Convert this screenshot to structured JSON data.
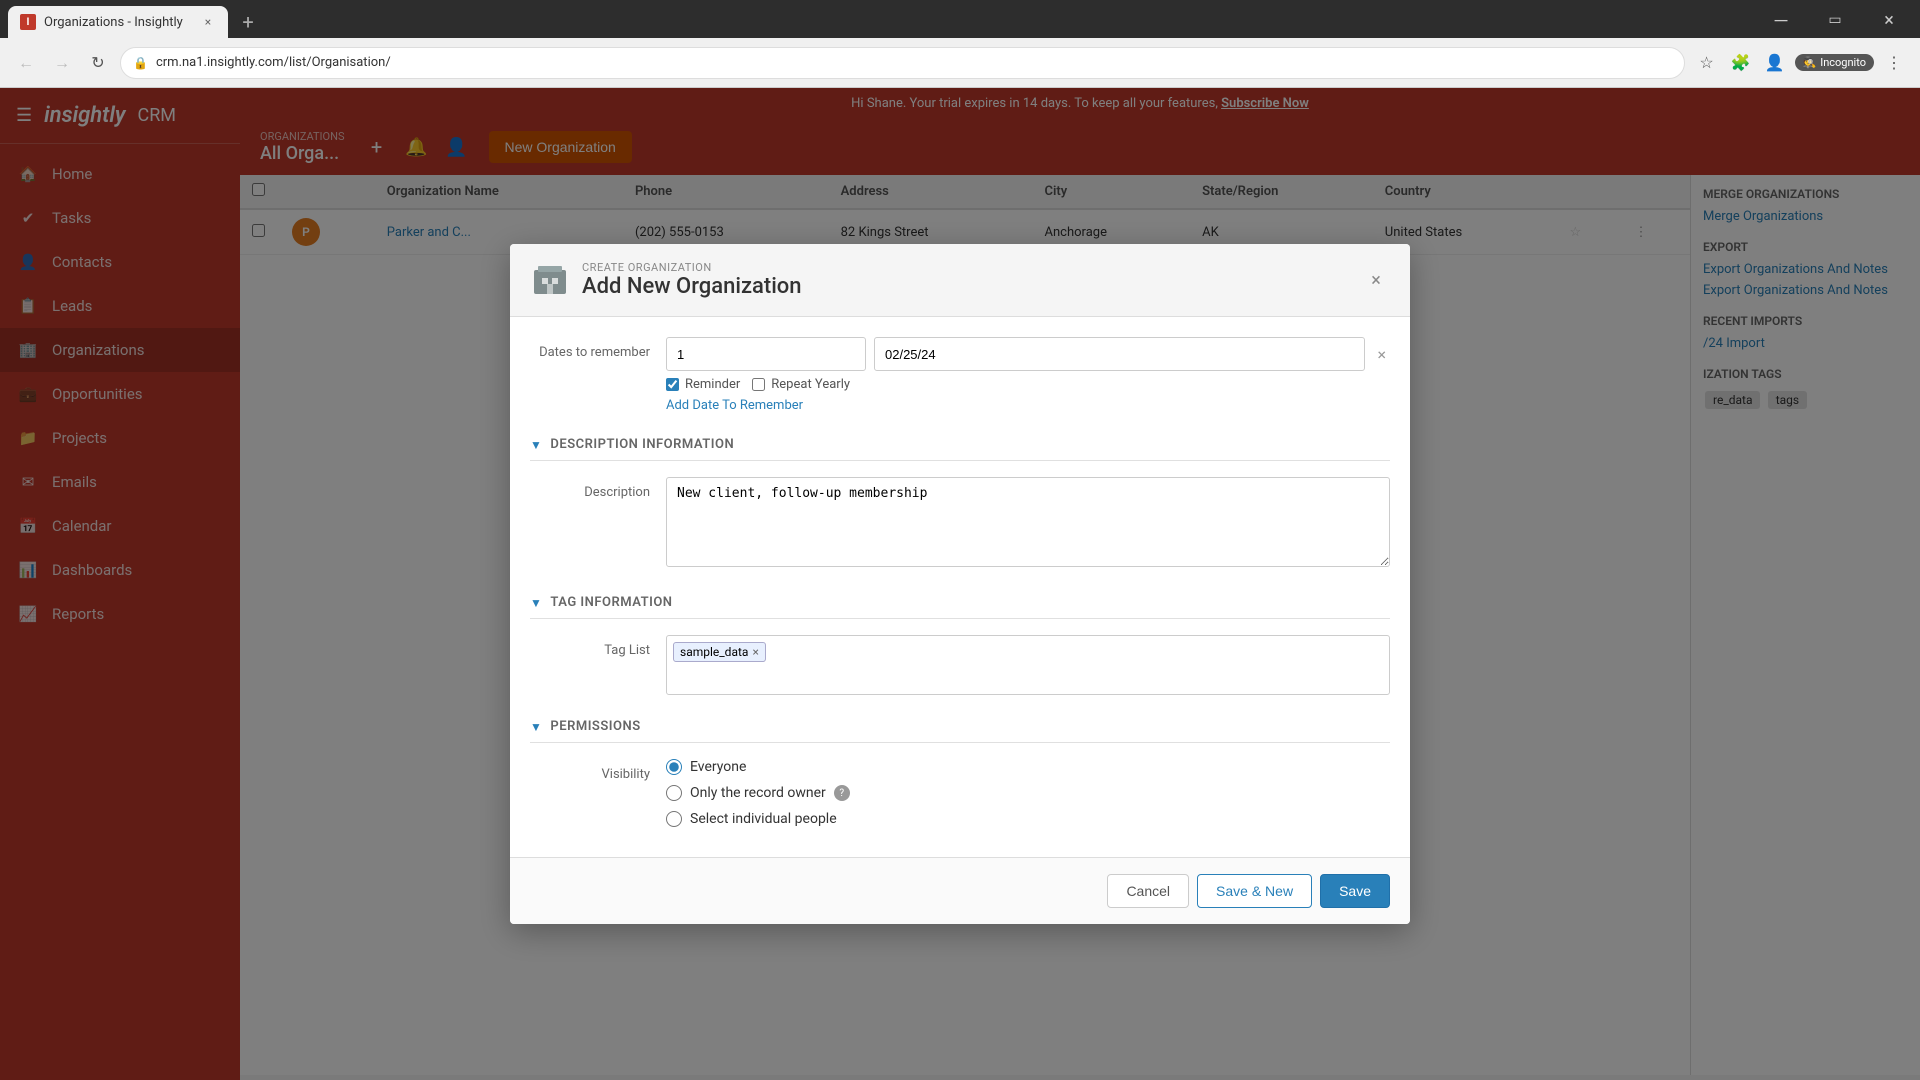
{
  "browser": {
    "tab_title": "Organizations - Insightly",
    "url": "crm.na1.insightly.com/list/Organisation/",
    "new_tab_btn": "+",
    "incognito_label": "Incognito"
  },
  "banner": {
    "text": "Hi Shane. Your trial expires in 14 days. To keep all your features,",
    "link": "Subscribe Now"
  },
  "sidebar": {
    "logo": "insightly",
    "crm": "CRM",
    "items": [
      {
        "id": "home",
        "label": "Home",
        "icon": "🏠"
      },
      {
        "id": "tasks",
        "label": "Tasks",
        "icon": "✔"
      },
      {
        "id": "contacts",
        "label": "Contacts",
        "icon": "👤"
      },
      {
        "id": "leads",
        "label": "Leads",
        "icon": "📋"
      },
      {
        "id": "organizations",
        "label": "Organizations",
        "icon": "🏢"
      },
      {
        "id": "opportunities",
        "label": "Opportunities",
        "icon": "💼"
      },
      {
        "id": "projects",
        "label": "Projects",
        "icon": "📁"
      },
      {
        "id": "emails",
        "label": "Emails",
        "icon": "✉"
      },
      {
        "id": "calendar",
        "label": "Calendar",
        "icon": "📅"
      },
      {
        "id": "dashboards",
        "label": "Dashboards",
        "icon": "📊"
      },
      {
        "id": "reports",
        "label": "Reports",
        "icon": "📈"
      }
    ]
  },
  "page": {
    "title": "All Orga...",
    "new_org_btn": "New Organization"
  },
  "right_sidebar": {
    "merge_title": "MERGE ORGANIZATIONS",
    "merge_link": "Merge Organizations",
    "export_title": "EXPORT",
    "export_link1": "t Organizations And Notes",
    "export_link2": "t Organizations And Notes",
    "recent_title": "RECENT IMPORTS",
    "recent_link": "/24 Import",
    "tags_title": "IZATION TAGS",
    "tag1": "re_data",
    "tag2": "tags"
  },
  "modal": {
    "subtitle": "CREATE ORGANIZATION",
    "title": "Add New Organization",
    "close_btn": "×",
    "sections": {
      "dates_label": "Dates to remember",
      "date_value1": "1",
      "date_value2": "02/25/24",
      "reminder_label": "Reminder",
      "repeat_yearly_label": "Repeat Yearly",
      "add_date_link": "Add Date To Remember",
      "description_section": "DESCRIPTION INFORMATION",
      "description_label": "Description",
      "description_value": "New client, follow-up membership",
      "description_placeholder": "",
      "tag_section": "TAG INFORMATION",
      "tag_label": "Tag List",
      "tag_value": "sample_data",
      "permissions_section": "PERMISSIONS",
      "visibility_label": "Visibility",
      "visibility_options": [
        {
          "id": "everyone",
          "label": "Everyone",
          "selected": true
        },
        {
          "id": "owner_only",
          "label": "Only the record owner",
          "selected": false
        },
        {
          "id": "select_people",
          "label": "Select individual people",
          "selected": false
        }
      ]
    },
    "footer": {
      "cancel_label": "Cancel",
      "save_new_label": "Save & New",
      "save_label": "Save"
    }
  },
  "table": {
    "columns": [
      "",
      "",
      "Organization Name",
      "Phone",
      "Address",
      "City",
      "State/Region",
      "Country",
      "",
      ""
    ],
    "rows": [
      {
        "name": "Parker and C...",
        "phone": "(202) 555-0153",
        "address": "82 Kings Street",
        "city": "Anchorage",
        "state": "AK",
        "country": "United States",
        "avatar_color": "#e67e22"
      }
    ]
  }
}
